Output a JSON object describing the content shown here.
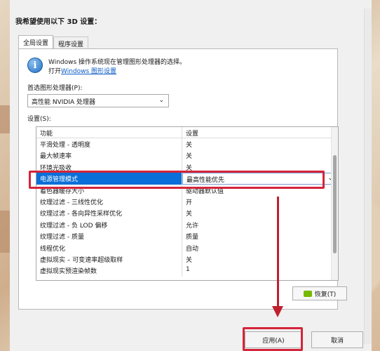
{
  "window": {
    "heading": "我希望使用以下 3D 设置："
  },
  "tabs": [
    {
      "label": "全局设置",
      "active": true
    },
    {
      "label": "程序设置",
      "active": false
    }
  ],
  "info": {
    "line1": "Windows 操作系统现在管理图形处理器的选择。",
    "line2_prefix": "打开",
    "link": "Windows 图形设置"
  },
  "gpu": {
    "label": "首选图形处理器(P):",
    "selected": "高性能 NVIDIA 处理器"
  },
  "settings": {
    "label": "设置(S):",
    "headers": {
      "feature": "功能",
      "setting": "设置"
    },
    "rows": [
      {
        "feature": "平滑处理 - 透明度",
        "value": "关"
      },
      {
        "feature": "最大帧速率",
        "value": "关"
      },
      {
        "feature": "环境光吸收",
        "value": "关"
      },
      {
        "feature": "电源管理模式",
        "value": "最高性能优先",
        "selected": true
      },
      {
        "feature": "着色器缓存大小",
        "value": "驱动器默认值"
      },
      {
        "feature": "纹理过滤 - 三线性优化",
        "value": "开"
      },
      {
        "feature": "纹理过滤 - 各向异性采样优化",
        "value": "关"
      },
      {
        "feature": "纹理过滤 - 负 LOD 偏移",
        "value": "允许"
      },
      {
        "feature": "纹理过滤 - 质量",
        "value": "质量"
      },
      {
        "feature": "线程优化",
        "value": "自动"
      },
      {
        "feature": "虚拟现实 – 可变速率超级取样",
        "value": "关"
      },
      {
        "feature": "虚拟现实预渲染帧数",
        "value": "1"
      }
    ]
  },
  "buttons": {
    "restore": "恢复(T)",
    "apply": "应用(A)",
    "cancel": "取消"
  },
  "colors": {
    "selection": "#0a6fd8",
    "annotation": "#d4253a",
    "nvidia": "#76b900"
  }
}
